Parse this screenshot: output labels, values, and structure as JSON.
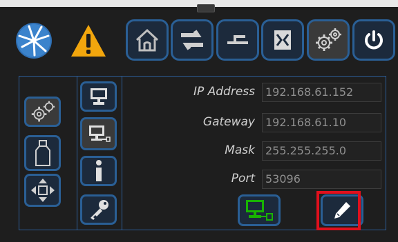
{
  "form": {
    "ip_address_label": "IP Address",
    "ip_address_value": "192.168.61.152",
    "gateway_label": "Gateway",
    "gateway_value": "192.168.61.10",
    "mask_label": "Mask",
    "mask_value": "255.255.255.0",
    "port_label": "Port",
    "port_value": "53096"
  },
  "toolbar": {
    "icons": [
      "logo-icon",
      "warning-icon",
      "home-icon",
      "transfer-icon",
      "connect-icon",
      "import-icon",
      "settings-icon",
      "power-icon"
    ]
  },
  "sidebar": {
    "left_icons": [
      "settings-icon",
      "weight-icon",
      "move-icon"
    ],
    "right_icons": [
      "monitor-icon",
      "network-monitor-icon",
      "info-icon",
      "key-icon"
    ]
  },
  "actions": {
    "icons": [
      "network-connect-icon",
      "edit-icon"
    ]
  },
  "colors": {
    "accent_border": "#2a5f95",
    "button_fill": "#1c2a3c",
    "warning": "#f2a60d",
    "network_green": "#18b300",
    "highlight": "#e0101d"
  }
}
